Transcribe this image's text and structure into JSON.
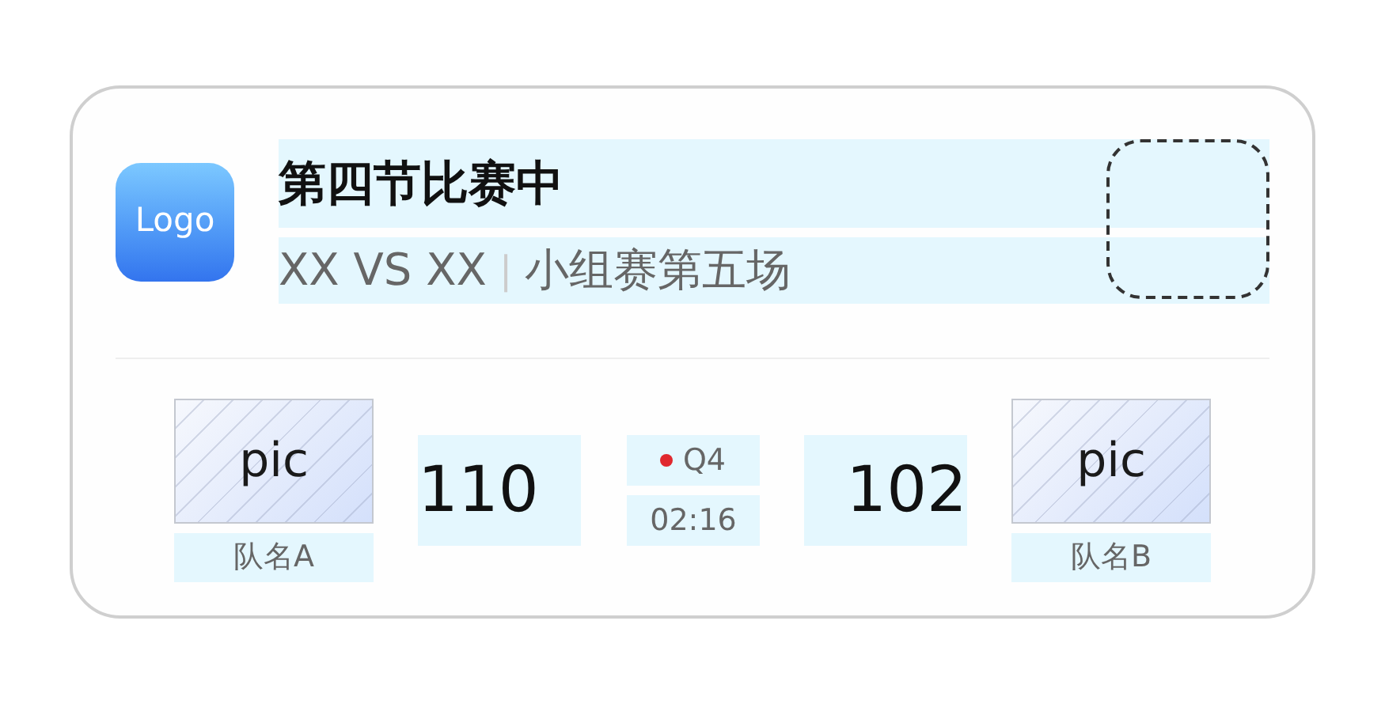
{
  "header": {
    "logo": "Logo",
    "title": "第四节比赛中",
    "matchup": "XX VS XX",
    "separator": "|",
    "stage": "小组赛第五场"
  },
  "teams": [
    {
      "picture_label": "pic",
      "name": "队名A",
      "score": "110"
    },
    {
      "picture_label": "pic",
      "name": "队名B",
      "score": "102"
    }
  ],
  "status": {
    "live": true,
    "period": "Q4",
    "clock": "02:16"
  }
}
